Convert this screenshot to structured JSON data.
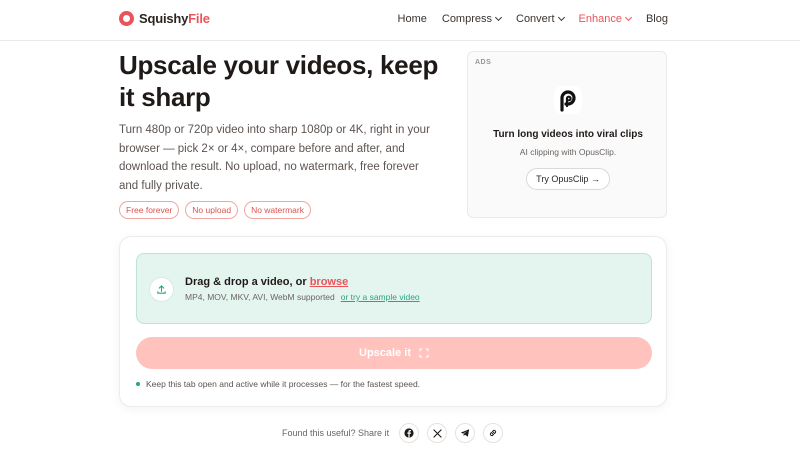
{
  "brand": {
    "name_part1": "Squishy",
    "name_part2": "File"
  },
  "nav": {
    "home": "Home",
    "compress": "Compress",
    "convert": "Convert",
    "enhance": "Enhance",
    "blog": "Blog",
    "active": "Enhance"
  },
  "hero": {
    "title": "Upscale your videos, keep it sharp",
    "description": "Turn 480p or 720p video into sharp 1080p or 4K, right in your browser — pick 2× or 4×, compare before and after, and download the result. No upload, no watermark, free forever and fully private.",
    "badges": [
      "Free forever",
      "No upload",
      "No watermark"
    ]
  },
  "ad": {
    "label": "ADS",
    "title": "Turn long videos into viral clips",
    "subtitle": "AI clipping with OpusClip.",
    "button": "Try OpusClip →"
  },
  "upload": {
    "title_prefix": "Drag & drop a video, or ",
    "browse": "browse",
    "formats": "MP4, MOV, MKV, AVI, WebM supported",
    "sample_link": "or try a sample video"
  },
  "action": {
    "upscale_label": "Upscale it"
  },
  "tip": "Keep this tab open and active while it processes — for the fastest speed.",
  "share": {
    "label": "Found this useful? Share it"
  },
  "colors": {
    "brand_red": "#e8545a",
    "accent_green": "#2aa486",
    "drop_bg": "#e4f4ee",
    "button_disabled": "#ffc2bd"
  },
  "icons": [
    "upload-icon",
    "expand-icon",
    "facebook-icon",
    "x-icon",
    "telegram-icon",
    "link-icon",
    "chevron-down-icon",
    "opusclip-logo-icon"
  ]
}
